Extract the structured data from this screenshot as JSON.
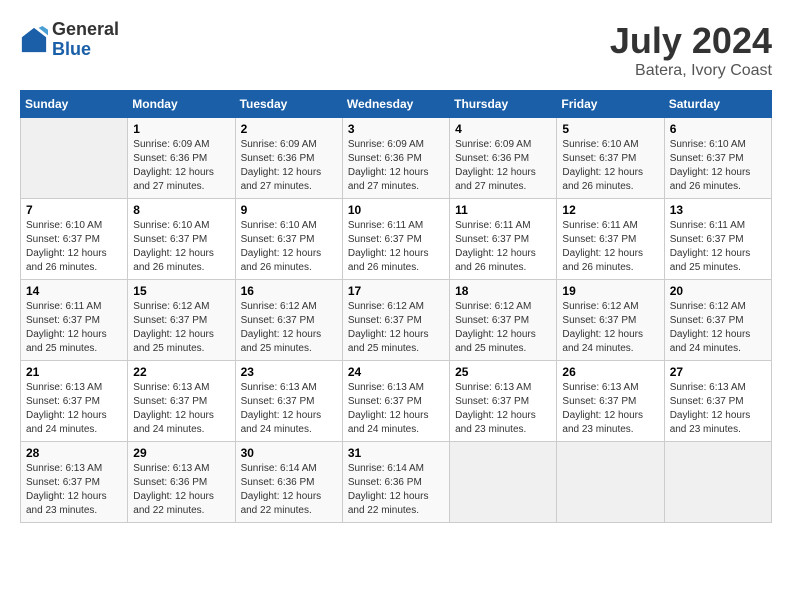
{
  "header": {
    "logo_general": "General",
    "logo_blue": "Blue",
    "month_year": "July 2024",
    "location": "Batera, Ivory Coast"
  },
  "calendar": {
    "days_of_week": [
      "Sunday",
      "Monday",
      "Tuesday",
      "Wednesday",
      "Thursday",
      "Friday",
      "Saturday"
    ],
    "weeks": [
      [
        {
          "day": "",
          "sunrise": "",
          "sunset": "",
          "daylight": "",
          "empty": true
        },
        {
          "day": "1",
          "sunrise": "Sunrise: 6:09 AM",
          "sunset": "Sunset: 6:36 PM",
          "daylight": "Daylight: 12 hours and 27 minutes.",
          "empty": false
        },
        {
          "day": "2",
          "sunrise": "Sunrise: 6:09 AM",
          "sunset": "Sunset: 6:36 PM",
          "daylight": "Daylight: 12 hours and 27 minutes.",
          "empty": false
        },
        {
          "day": "3",
          "sunrise": "Sunrise: 6:09 AM",
          "sunset": "Sunset: 6:36 PM",
          "daylight": "Daylight: 12 hours and 27 minutes.",
          "empty": false
        },
        {
          "day": "4",
          "sunrise": "Sunrise: 6:09 AM",
          "sunset": "Sunset: 6:36 PM",
          "daylight": "Daylight: 12 hours and 27 minutes.",
          "empty": false
        },
        {
          "day": "5",
          "sunrise": "Sunrise: 6:10 AM",
          "sunset": "Sunset: 6:37 PM",
          "daylight": "Daylight: 12 hours and 26 minutes.",
          "empty": false
        },
        {
          "day": "6",
          "sunrise": "Sunrise: 6:10 AM",
          "sunset": "Sunset: 6:37 PM",
          "daylight": "Daylight: 12 hours and 26 minutes.",
          "empty": false
        }
      ],
      [
        {
          "day": "7",
          "sunrise": "Sunrise: 6:10 AM",
          "sunset": "Sunset: 6:37 PM",
          "daylight": "Daylight: 12 hours and 26 minutes.",
          "empty": false
        },
        {
          "day": "8",
          "sunrise": "Sunrise: 6:10 AM",
          "sunset": "Sunset: 6:37 PM",
          "daylight": "Daylight: 12 hours and 26 minutes.",
          "empty": false
        },
        {
          "day": "9",
          "sunrise": "Sunrise: 6:10 AM",
          "sunset": "Sunset: 6:37 PM",
          "daylight": "Daylight: 12 hours and 26 minutes.",
          "empty": false
        },
        {
          "day": "10",
          "sunrise": "Sunrise: 6:11 AM",
          "sunset": "Sunset: 6:37 PM",
          "daylight": "Daylight: 12 hours and 26 minutes.",
          "empty": false
        },
        {
          "day": "11",
          "sunrise": "Sunrise: 6:11 AM",
          "sunset": "Sunset: 6:37 PM",
          "daylight": "Daylight: 12 hours and 26 minutes.",
          "empty": false
        },
        {
          "day": "12",
          "sunrise": "Sunrise: 6:11 AM",
          "sunset": "Sunset: 6:37 PM",
          "daylight": "Daylight: 12 hours and 26 minutes.",
          "empty": false
        },
        {
          "day": "13",
          "sunrise": "Sunrise: 6:11 AM",
          "sunset": "Sunset: 6:37 PM",
          "daylight": "Daylight: 12 hours and 25 minutes.",
          "empty": false
        }
      ],
      [
        {
          "day": "14",
          "sunrise": "Sunrise: 6:11 AM",
          "sunset": "Sunset: 6:37 PM",
          "daylight": "Daylight: 12 hours and 25 minutes.",
          "empty": false
        },
        {
          "day": "15",
          "sunrise": "Sunrise: 6:12 AM",
          "sunset": "Sunset: 6:37 PM",
          "daylight": "Daylight: 12 hours and 25 minutes.",
          "empty": false
        },
        {
          "day": "16",
          "sunrise": "Sunrise: 6:12 AM",
          "sunset": "Sunset: 6:37 PM",
          "daylight": "Daylight: 12 hours and 25 minutes.",
          "empty": false
        },
        {
          "day": "17",
          "sunrise": "Sunrise: 6:12 AM",
          "sunset": "Sunset: 6:37 PM",
          "daylight": "Daylight: 12 hours and 25 minutes.",
          "empty": false
        },
        {
          "day": "18",
          "sunrise": "Sunrise: 6:12 AM",
          "sunset": "Sunset: 6:37 PM",
          "daylight": "Daylight: 12 hours and 25 minutes.",
          "empty": false
        },
        {
          "day": "19",
          "sunrise": "Sunrise: 6:12 AM",
          "sunset": "Sunset: 6:37 PM",
          "daylight": "Daylight: 12 hours and 24 minutes.",
          "empty": false
        },
        {
          "day": "20",
          "sunrise": "Sunrise: 6:12 AM",
          "sunset": "Sunset: 6:37 PM",
          "daylight": "Daylight: 12 hours and 24 minutes.",
          "empty": false
        }
      ],
      [
        {
          "day": "21",
          "sunrise": "Sunrise: 6:13 AM",
          "sunset": "Sunset: 6:37 PM",
          "daylight": "Daylight: 12 hours and 24 minutes.",
          "empty": false
        },
        {
          "day": "22",
          "sunrise": "Sunrise: 6:13 AM",
          "sunset": "Sunset: 6:37 PM",
          "daylight": "Daylight: 12 hours and 24 minutes.",
          "empty": false
        },
        {
          "day": "23",
          "sunrise": "Sunrise: 6:13 AM",
          "sunset": "Sunset: 6:37 PM",
          "daylight": "Daylight: 12 hours and 24 minutes.",
          "empty": false
        },
        {
          "day": "24",
          "sunrise": "Sunrise: 6:13 AM",
          "sunset": "Sunset: 6:37 PM",
          "daylight": "Daylight: 12 hours and 24 minutes.",
          "empty": false
        },
        {
          "day": "25",
          "sunrise": "Sunrise: 6:13 AM",
          "sunset": "Sunset: 6:37 PM",
          "daylight": "Daylight: 12 hours and 23 minutes.",
          "empty": false
        },
        {
          "day": "26",
          "sunrise": "Sunrise: 6:13 AM",
          "sunset": "Sunset: 6:37 PM",
          "daylight": "Daylight: 12 hours and 23 minutes.",
          "empty": false
        },
        {
          "day": "27",
          "sunrise": "Sunrise: 6:13 AM",
          "sunset": "Sunset: 6:37 PM",
          "daylight": "Daylight: 12 hours and 23 minutes.",
          "empty": false
        }
      ],
      [
        {
          "day": "28",
          "sunrise": "Sunrise: 6:13 AM",
          "sunset": "Sunset: 6:37 PM",
          "daylight": "Daylight: 12 hours and 23 minutes.",
          "empty": false
        },
        {
          "day": "29",
          "sunrise": "Sunrise: 6:13 AM",
          "sunset": "Sunset: 6:36 PM",
          "daylight": "Daylight: 12 hours and 22 minutes.",
          "empty": false
        },
        {
          "day": "30",
          "sunrise": "Sunrise: 6:14 AM",
          "sunset": "Sunset: 6:36 PM",
          "daylight": "Daylight: 12 hours and 22 minutes.",
          "empty": false
        },
        {
          "day": "31",
          "sunrise": "Sunrise: 6:14 AM",
          "sunset": "Sunset: 6:36 PM",
          "daylight": "Daylight: 12 hours and 22 minutes.",
          "empty": false
        },
        {
          "day": "",
          "sunrise": "",
          "sunset": "",
          "daylight": "",
          "empty": true
        },
        {
          "day": "",
          "sunrise": "",
          "sunset": "",
          "daylight": "",
          "empty": true
        },
        {
          "day": "",
          "sunrise": "",
          "sunset": "",
          "daylight": "",
          "empty": true
        }
      ]
    ]
  }
}
